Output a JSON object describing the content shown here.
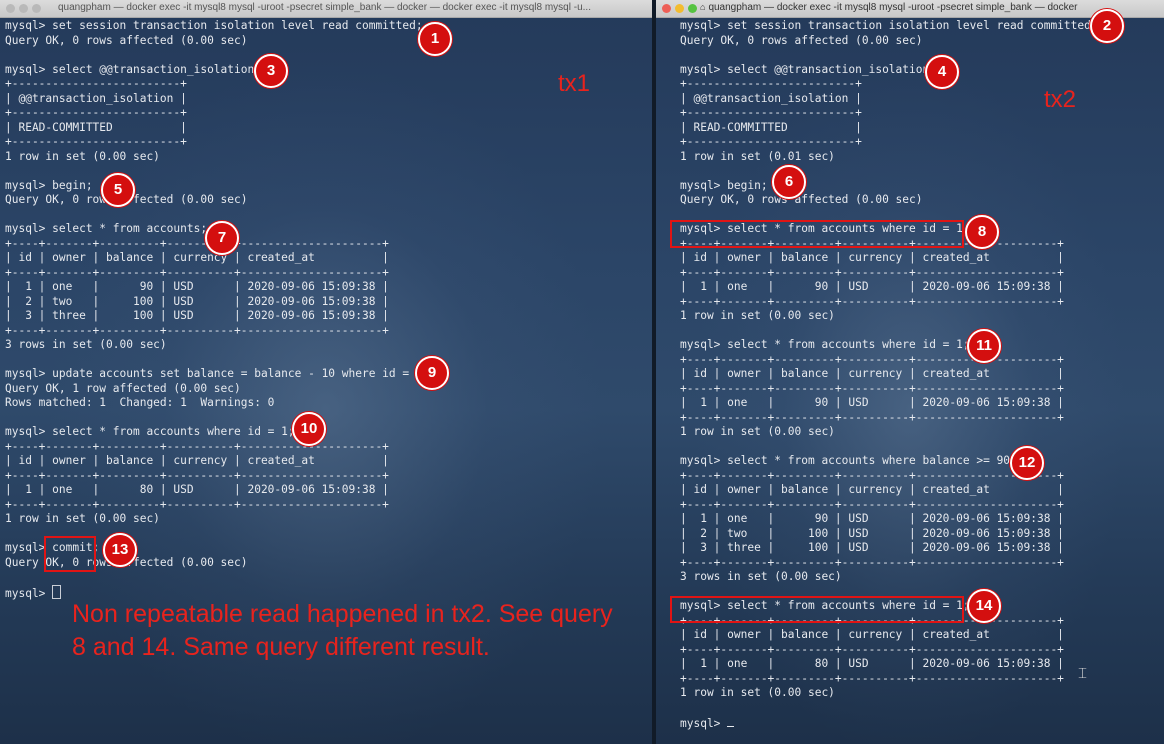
{
  "colors": {
    "annotation_red": "#e11414",
    "terminal_text": "#e6e9ee"
  },
  "left_window": {
    "title": "quangpham — docker exec -it mysql8 mysql -uroot -psecret simple_bank — docker — docker exec -it mysql8 mysql -u...",
    "label": "tx1",
    "lines": [
      "mysql> set session transaction isolation level read committed;",
      "Query OK, 0 rows affected (0.00 sec)",
      "",
      "mysql> select @@transaction_isolation;",
      "+-------------------------+",
      "| @@transaction_isolation |",
      "+-------------------------+",
      "| READ-COMMITTED          |",
      "+-------------------------+",
      "1 row in set (0.00 sec)",
      "",
      "mysql> begin;",
      "Query OK, 0 rows affected (0.00 sec)",
      "",
      "mysql> select * from accounts;",
      "+----+-------+---------+----------+---------------------+",
      "| id | owner | balance | currency | created_at          |",
      "+----+-------+---------+----------+---------------------+",
      "|  1 | one   |      90 | USD      | 2020-09-06 15:09:38 |",
      "|  2 | two   |     100 | USD      | 2020-09-06 15:09:38 |",
      "|  3 | three |     100 | USD      | 2020-09-06 15:09:38 |",
      "+----+-------+---------+----------+---------------------+",
      "3 rows in set (0.00 sec)",
      "",
      "mysql> update accounts set balance = balance - 10 where id = 1;",
      "Query OK, 1 row affected (0.00 sec)",
      "Rows matched: 1  Changed: 1  Warnings: 0",
      "",
      "mysql> select * from accounts where id = 1;",
      "+----+-------+---------+----------+---------------------+",
      "| id | owner | balance | currency | created_at          |",
      "+----+-------+---------+----------+---------------------+",
      "|  1 | one   |      80 | USD      | 2020-09-06 15:09:38 |",
      "+----+-------+---------+----------+---------------------+",
      "1 row in set (0.00 sec)",
      "",
      "mysql> commit;",
      "Query OK, 0 rows affected (0.00 sec)",
      ""
    ],
    "prompt": "mysql> "
  },
  "right_window": {
    "title": "quangpham — docker exec -it mysql8 mysql -uroot -psecret simple_bank — docker",
    "label": "tx2",
    "lines": [
      "mysql> set session transaction isolation level read committed;",
      "Query OK, 0 rows affected (0.00 sec)",
      "",
      "mysql> select @@transaction_isolation;",
      "+-------------------------+",
      "| @@transaction_isolation |",
      "+-------------------------+",
      "| READ-COMMITTED          |",
      "+-------------------------+",
      "1 row in set (0.01 sec)",
      "",
      "mysql> begin;",
      "Query OK, 0 rows affected (0.00 sec)",
      "",
      "mysql> select * from accounts where id = 1;",
      "+----+-------+---------+----------+---------------------+",
      "| id | owner | balance | currency | created_at          |",
      "+----+-------+---------+----------+---------------------+",
      "|  1 | one   |      90 | USD      | 2020-09-06 15:09:38 |",
      "+----+-------+---------+----------+---------------------+",
      "1 row in set (0.00 sec)",
      "",
      "mysql> select * from accounts where id = 1;",
      "+----+-------+---------+----------+---------------------+",
      "| id | owner | balance | currency | created_at          |",
      "+----+-------+---------+----------+---------------------+",
      "|  1 | one   |      90 | USD      | 2020-09-06 15:09:38 |",
      "+----+-------+---------+----------+---------------------+",
      "1 row in set (0.00 sec)",
      "",
      "mysql> select * from accounts where balance >= 90;",
      "+----+-------+---------+----------+---------------------+",
      "| id | owner | balance | currency | created_at          |",
      "+----+-------+---------+----------+---------------------+",
      "|  1 | one   |      90 | USD      | 2020-09-06 15:09:38 |",
      "|  2 | two   |     100 | USD      | 2020-09-06 15:09:38 |",
      "|  3 | three |     100 | USD      | 2020-09-06 15:09:38 |",
      "+----+-------+---------+----------+---------------------+",
      "3 rows in set (0.00 sec)",
      "",
      "mysql> select * from accounts where id = 1;",
      "+----+-------+---------+----------+---------------------+",
      "| id | owner | balance | currency | created_at          |",
      "+----+-------+---------+----------+---------------------+",
      "|  1 | one   |      80 | USD      | 2020-09-06 15:09:38 |",
      "+----+-------+---------+----------+---------------------+",
      "1 row in set (0.00 sec)",
      ""
    ],
    "prompt": "mysql> "
  },
  "annotations": {
    "badges": [
      "1",
      "2",
      "3",
      "4",
      "5",
      "6",
      "7",
      "8",
      "9",
      "10",
      "11",
      "12",
      "13",
      "14"
    ],
    "note": "Non repeatable read happened in tx2. See query 8 and 14. Same query different result."
  }
}
